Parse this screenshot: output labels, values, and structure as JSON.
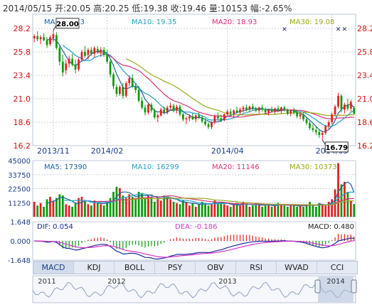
{
  "header": {
    "text": "2014/05/15 开:20.05  高:20.25  低:19.38  收:19.46  量:10153  幅:-2.65%"
  },
  "colors": {
    "up": "#e02020",
    "down": "#0a9a0a",
    "ma5": "#1f5fa0",
    "ma10": "#22a0c8",
    "ma20": "#d6337a",
    "ma30": "#9aa81c",
    "grid": "#c9cfdc",
    "axis_text": "#d41010",
    "label_text": "#1d3f8a"
  },
  "chart_data": [
    {
      "type": "candlestick",
      "id": "price",
      "legend": [
        {
          "name": "MA5",
          "value": "19.73",
          "color": "#1f5fa0"
        },
        {
          "name": "MA10",
          "value": "19.35",
          "color": "#22a0c8"
        },
        {
          "name": "MA20",
          "value": "18.93",
          "color": "#d6337a"
        },
        {
          "name": "MA30",
          "value": "19.08",
          "color": "#9aa81c"
        }
      ],
      "y_ticks": [
        "28.2",
        "25.8",
        "23.4",
        "21.0",
        "18.6",
        "16.2"
      ],
      "ylim": [
        16.2,
        28.2
      ],
      "x_ticks": [
        {
          "label": "2013/11",
          "index": 6
        },
        {
          "label": "2014/02",
          "index": 23
        },
        {
          "label": "2014/04",
          "index": 61
        },
        {
          "label": "2014/05",
          "index": 94
        }
      ],
      "max_label": {
        "text": "28.00",
        "index": 6,
        "value": 28.0
      },
      "min_label": {
        "text": "16.79",
        "index": 91,
        "value": 16.79
      },
      "markers": [
        {
          "index": 79,
          "symbol": "✕"
        },
        {
          "index": 96,
          "symbol": "✕"
        },
        {
          "index": 98,
          "symbol": "✕"
        }
      ],
      "candles": [
        [
          27.2,
          27.6,
          26.8,
          27.4
        ],
        [
          27.4,
          27.9,
          26.9,
          27.1
        ],
        [
          27.1,
          27.5,
          26.6,
          27.3
        ],
        [
          27.3,
          27.7,
          26.9,
          27.0
        ],
        [
          27.0,
          27.3,
          26.2,
          26.5
        ],
        [
          26.6,
          27.5,
          26.4,
          27.3
        ],
        [
          27.2,
          28.0,
          26.8,
          27.6
        ],
        [
          27.5,
          27.8,
          26.0,
          26.2
        ],
        [
          26.2,
          26.5,
          24.4,
          24.8
        ],
        [
          24.8,
          25.5,
          23.3,
          23.7
        ],
        [
          23.9,
          25.0,
          23.5,
          24.6
        ],
        [
          24.6,
          25.4,
          24.2,
          25.1
        ],
        [
          25.1,
          25.6,
          24.3,
          24.5
        ],
        [
          24.5,
          25.0,
          23.6,
          24.0
        ],
        [
          24.0,
          25.2,
          23.8,
          25.0
        ],
        [
          25.0,
          26.0,
          24.8,
          25.8
        ],
        [
          25.8,
          26.4,
          25.2,
          25.4
        ],
        [
          25.5,
          26.2,
          25.0,
          26.0
        ],
        [
          26.0,
          26.3,
          25.4,
          25.6
        ],
        [
          25.6,
          26.4,
          25.2,
          26.2
        ],
        [
          26.1,
          26.4,
          25.6,
          25.8
        ],
        [
          25.8,
          26.3,
          25.3,
          26.0
        ],
        [
          26.0,
          26.3,
          25.3,
          25.5
        ],
        [
          25.5,
          26.0,
          24.6,
          24.8
        ],
        [
          24.8,
          25.0,
          23.2,
          23.5
        ],
        [
          23.5,
          23.7,
          22.0,
          22.3
        ],
        [
          22.2,
          22.5,
          21.2,
          21.5
        ],
        [
          21.5,
          22.4,
          21.3,
          22.2
        ],
        [
          22.2,
          22.6,
          21.0,
          21.3
        ],
        [
          21.3,
          22.8,
          21.1,
          22.6
        ],
        [
          22.6,
          23.4,
          22.3,
          23.1
        ],
        [
          23.1,
          23.5,
          22.1,
          22.3
        ],
        [
          22.3,
          22.6,
          21.6,
          21.9
        ],
        [
          21.9,
          22.3,
          20.6,
          20.8
        ],
        [
          20.8,
          21.2,
          19.9,
          20.1
        ],
        [
          20.1,
          20.4,
          19.3,
          19.6
        ],
        [
          19.6,
          20.6,
          19.4,
          20.4
        ],
        [
          20.4,
          20.6,
          19.6,
          19.8
        ],
        [
          19.8,
          20.0,
          18.9,
          19.1
        ],
        [
          19.1,
          19.5,
          18.6,
          19.3
        ],
        [
          19.3,
          20.1,
          19.2,
          19.9
        ],
        [
          19.9,
          20.2,
          19.4,
          19.6
        ],
        [
          19.6,
          20.3,
          19.4,
          20.1
        ],
        [
          20.1,
          20.6,
          19.8,
          20.3
        ],
        [
          20.3,
          20.5,
          19.6,
          19.8
        ],
        [
          19.8,
          20.4,
          19.5,
          20.2
        ],
        [
          20.2,
          20.4,
          19.2,
          19.4
        ],
        [
          19.4,
          19.6,
          18.7,
          18.9
        ],
        [
          18.9,
          19.2,
          18.4,
          19.0
        ],
        [
          19.0,
          19.4,
          18.7,
          19.2
        ],
        [
          19.2,
          19.5,
          18.8,
          18.9
        ],
        [
          18.9,
          19.4,
          18.6,
          19.3
        ],
        [
          19.3,
          19.6,
          18.9,
          19.1
        ],
        [
          19.1,
          19.3,
          18.5,
          18.7
        ],
        [
          18.7,
          19.0,
          18.2,
          18.4
        ],
        [
          18.4,
          18.6,
          17.9,
          18.1
        ],
        [
          18.1,
          18.7,
          17.9,
          18.6
        ],
        [
          18.6,
          19.4,
          18.4,
          19.2
        ],
        [
          19.2,
          19.6,
          18.8,
          19.0
        ],
        [
          19.0,
          19.4,
          18.6,
          18.8
        ],
        [
          18.8,
          19.5,
          18.7,
          19.4
        ],
        [
          19.4,
          19.9,
          19.2,
          19.7
        ],
        [
          19.7,
          20.0,
          19.3,
          19.5
        ],
        [
          19.5,
          19.9,
          19.2,
          19.8
        ],
        [
          19.8,
          20.2,
          19.5,
          19.6
        ],
        [
          19.6,
          20.1,
          19.4,
          19.9
        ],
        [
          19.9,
          20.3,
          19.6,
          20.1
        ],
        [
          20.1,
          20.4,
          19.7,
          19.9
        ],
        [
          19.9,
          20.3,
          19.6,
          20.2
        ],
        [
          20.2,
          20.5,
          19.8,
          20.0
        ],
        [
          20.0,
          20.2,
          19.6,
          19.8
        ],
        [
          19.8,
          20.2,
          19.5,
          20.1
        ],
        [
          20.1,
          20.4,
          19.7,
          19.9
        ],
        [
          19.9,
          20.1,
          19.4,
          19.6
        ],
        [
          19.6,
          20.0,
          19.3,
          19.9
        ],
        [
          19.9,
          20.2,
          19.6,
          19.7
        ],
        [
          19.7,
          20.1,
          19.4,
          20.0
        ],
        [
          20.0,
          20.3,
          19.6,
          19.8
        ],
        [
          19.8,
          20.2,
          19.5,
          20.1
        ],
        [
          20.1,
          20.3,
          19.7,
          19.9
        ],
        [
          19.9,
          20.0,
          19.3,
          19.5
        ],
        [
          19.5,
          19.9,
          19.2,
          19.8
        ],
        [
          19.8,
          20.1,
          19.4,
          19.6
        ],
        [
          19.6,
          19.8,
          19.0,
          19.2
        ],
        [
          19.2,
          19.6,
          18.9,
          19.4
        ],
        [
          19.4,
          19.6,
          18.7,
          18.9
        ],
        [
          18.9,
          19.1,
          18.3,
          18.5
        ],
        [
          18.5,
          18.7,
          17.8,
          18.0
        ],
        [
          18.0,
          18.4,
          17.6,
          17.8
        ],
        [
          17.8,
          18.2,
          17.3,
          17.6
        ],
        [
          17.6,
          17.9,
          17.0,
          17.3
        ],
        [
          17.3,
          17.7,
          16.79,
          17.5
        ],
        [
          17.5,
          18.3,
          17.3,
          18.2
        ],
        [
          18.2,
          18.8,
          17.9,
          18.6
        ],
        [
          18.6,
          19.6,
          18.4,
          19.4
        ],
        [
          19.4,
          20.4,
          19.2,
          20.2
        ],
        [
          20.2,
          21.6,
          20.0,
          21.3
        ],
        [
          21.3,
          21.5,
          19.6,
          19.9
        ],
        [
          19.9,
          20.6,
          19.5,
          20.4
        ],
        [
          20.4,
          21.0,
          19.8,
          20.0
        ],
        [
          20.0,
          20.9,
          19.7,
          20.7
        ],
        [
          20.05,
          20.25,
          19.38,
          19.46
        ]
      ]
    },
    {
      "type": "bar",
      "id": "volume",
      "legend": [
        {
          "name": "MA5",
          "value": "17390",
          "color": "#1f5fa0"
        },
        {
          "name": "MA10",
          "value": "16299",
          "color": "#22a0c8"
        },
        {
          "name": "MA20",
          "value": "11146",
          "color": "#d6337a"
        },
        {
          "name": "MA30",
          "value": "10373",
          "color": "#9aa81c"
        }
      ],
      "y_ticks": [
        "45000",
        "33750",
        "22500",
        "11250"
      ],
      "ylim": [
        0,
        45000
      ],
      "values": [
        12000,
        9000,
        11000,
        8000,
        14000,
        16000,
        13000,
        15000,
        18000,
        17000,
        10000,
        9000,
        8000,
        11000,
        15000,
        16000,
        12000,
        10000,
        9000,
        13000,
        11000,
        10000,
        9000,
        12000,
        15000,
        20000,
        24000,
        23000,
        17000,
        15000,
        18000,
        16000,
        14000,
        20000,
        19000,
        15000,
        18000,
        16000,
        12000,
        14000,
        13000,
        17000,
        16000,
        14000,
        12000,
        11000,
        10000,
        13000,
        12000,
        9000,
        11000,
        8000,
        10000,
        12000,
        11000,
        9000,
        10000,
        13000,
        11000,
        12000,
        10000,
        9000,
        8000,
        10000,
        11000,
        9000,
        12000,
        10000,
        8000,
        9000,
        11000,
        10000,
        8000,
        9000,
        10000,
        8000,
        9000,
        11000,
        10000,
        9000,
        8000,
        9000,
        10000,
        8000,
        9000,
        8000,
        10000,
        12000,
        9000,
        8000,
        11000,
        10000,
        9000,
        12000,
        14000,
        22000,
        43000,
        26000,
        28000,
        20000,
        13000,
        10153
      ]
    },
    {
      "type": "macd",
      "id": "macd",
      "legend": {
        "dif": "DIF: 0.054",
        "dea": "DEA: -0.186",
        "macd": "MACD: 0.480"
      },
      "y_ticks": [
        "1.648",
        "0.000",
        "-1.648"
      ],
      "ylim": [
        -1.648,
        1.648
      ]
    }
  ],
  "tabs": [
    "MACD",
    "KDJ",
    "BOLL",
    "PSY",
    "OBV",
    "RSI",
    "WVAD",
    "CCI"
  ],
  "navigator": {
    "year_labels": [
      "2011",
      "2012",
      "2013",
      "2014"
    ]
  }
}
